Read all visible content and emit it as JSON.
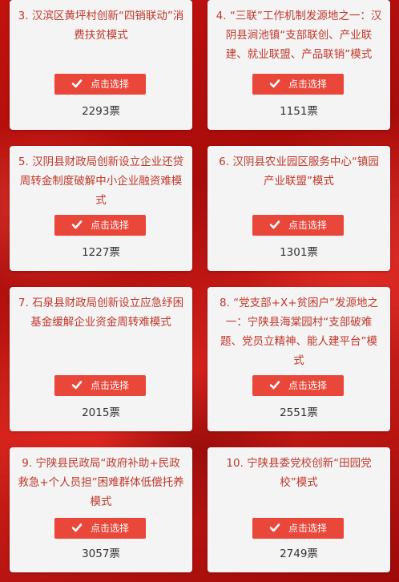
{
  "vote_unit": "票",
  "button_label": "点击选择",
  "cards": [
    {
      "title": "3. 汉滨区黄坪村创新“四销联动”消费扶贫模式",
      "votes": "2293"
    },
    {
      "title": "4. “三联”工作机制发源地之一：汉阴县涧池镇“支部联创、产业联建、就业联盟、产品联销”模式",
      "votes": "1151"
    },
    {
      "title": "5. 汉阴县财政局创新设立企业还贷周转金制度破解中小企业融资难模式",
      "votes": "1227"
    },
    {
      "title": "6. 汉阴县农业园区服务中心“镇园产业联盟”模式",
      "votes": "1301"
    },
    {
      "title": "7. 石泉县财政局创新设立应急纾困基金缓解企业资金周转难模式",
      "votes": "2015"
    },
    {
      "title": "8. “党支部+X+贫困户”发源地之一：宁陕县海棠园村“支部破难题、党员立精神、能人建平台”模式",
      "votes": "2551"
    },
    {
      "title": "9. 宁陕县民政局“政府补助+民政救急+个人员担”困难群体低偿托养模式",
      "votes": "3057"
    },
    {
      "title": "10. 宁陕县委党校创新“田园党校”模式",
      "votes": "2749"
    }
  ]
}
